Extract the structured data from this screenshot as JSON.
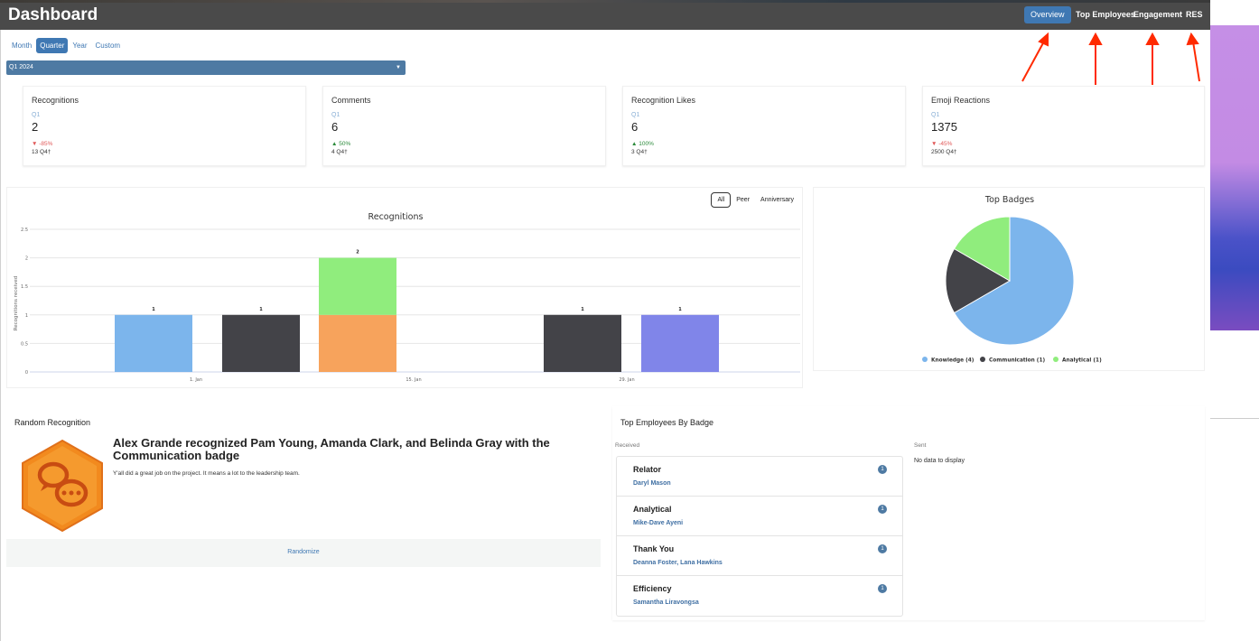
{
  "header": {
    "title": "Dashboard",
    "nav": [
      {
        "label": "Overview",
        "active": true
      },
      {
        "label": "Top Employees",
        "active": false
      },
      {
        "label": "Engagement",
        "active": false
      },
      {
        "label": "RES",
        "active": false
      }
    ]
  },
  "colors": {
    "accent": "#3f78b3",
    "header_bg": "#4a4a4a",
    "annotation_arrow": "#ff2a00",
    "down": "#e05858",
    "up": "#2a8a3a"
  },
  "range_tabs": [
    {
      "label": "Month",
      "active": false
    },
    {
      "label": "Quarter",
      "active": true
    },
    {
      "label": "Year",
      "active": false
    },
    {
      "label": "Custom",
      "active": false
    }
  ],
  "period_select": {
    "value": "Q1 2024"
  },
  "stats": [
    {
      "label": "Recognitions",
      "period": "Q1",
      "value": "2",
      "change": "▼ -85%",
      "direction": "down",
      "prev": "13 Q4†"
    },
    {
      "label": "Comments",
      "period": "Q1",
      "value": "6",
      "change": "▲ 50%",
      "direction": "up",
      "prev": "4 Q4†"
    },
    {
      "label": "Recognition Likes",
      "period": "Q1",
      "value": "6",
      "change": "▲ 100%",
      "direction": "up",
      "prev": "3 Q4†"
    },
    {
      "label": "Emoji Reactions",
      "period": "Q1",
      "value": "1375",
      "change": "▼ -45%",
      "direction": "down",
      "prev": "2500 Q4†"
    }
  ],
  "recognitions_chart": {
    "filters": [
      {
        "label": "All",
        "active": true
      },
      {
        "label": "Peer",
        "active": false
      },
      {
        "label": "Anniversary",
        "active": false
      }
    ]
  },
  "chart_data": [
    {
      "type": "bar",
      "title": "Recognitions",
      "ylabel": "Recognitions received",
      "xlabel": "",
      "ylim": [
        0,
        2.5
      ],
      "yticks": [
        "0",
        "0.5",
        "1",
        "1.5",
        "2",
        "2.5"
      ],
      "xticks": [
        "1. Jan",
        "15. Jan",
        "29. Jan"
      ],
      "stacked": true,
      "bars": [
        {
          "segments": [
            {
              "value": 1,
              "color": "#7cb5ec"
            }
          ],
          "total_label": "1"
        },
        {
          "segments": [
            {
              "value": 1,
              "color": "#434348"
            }
          ],
          "total_label": "1"
        },
        {
          "segments": [
            {
              "value": 1,
              "color": "#f7a35c"
            },
            {
              "value": 1,
              "color": "#90ed7d"
            }
          ],
          "total_label": "2"
        },
        {
          "segments": [
            {
              "value": 1,
              "color": "#434348"
            }
          ],
          "total_label": "1"
        },
        {
          "segments": [
            {
              "value": 1,
              "color": "#8085e9"
            }
          ],
          "total_label": "1"
        }
      ],
      "grid": true,
      "legend": "none"
    },
    {
      "type": "pie",
      "title": "Top Badges",
      "slices": [
        {
          "label": "Knowledge (4)",
          "value": 4,
          "color": "#7cb5ec"
        },
        {
          "label": "Communication (1)",
          "value": 1,
          "color": "#434348"
        },
        {
          "label": "Analytical (1)",
          "value": 1,
          "color": "#90ed7d"
        }
      ],
      "legend": "bottom"
    }
  ],
  "random_recognition": {
    "title": "Random Recognition",
    "headline": "Alex Grande recognized Pam Young, Amanda Clark, and Belinda Gray with the Communication badge",
    "message": "Y'all did a great job on the project. It means a lot to the leadership team.",
    "badge_icon": "communication-badge-icon",
    "randomize_label": "Randomize"
  },
  "top_employees": {
    "title": "Top Employees By Badge",
    "received_label": "Received",
    "sent_label": "Sent",
    "sent_empty": "No data to display",
    "received": [
      {
        "badge": "Relator",
        "people": "Daryl Mason",
        "count": "1"
      },
      {
        "badge": "Analytical",
        "people": "Mike-Dave Ayeni",
        "count": "1"
      },
      {
        "badge": "Thank You",
        "people": "Deanna Foster, Lana Hawkins",
        "count": "1"
      },
      {
        "badge": "Efficiency",
        "people": "Samantha Liravongsa",
        "count": "1"
      }
    ]
  }
}
